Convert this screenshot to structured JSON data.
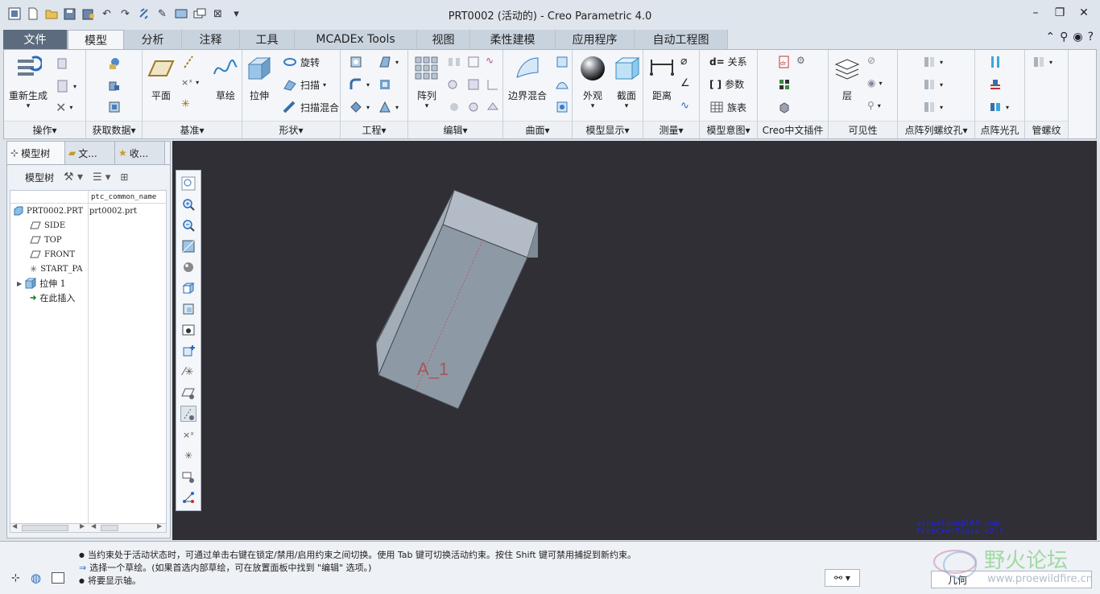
{
  "title": "PRT0002 (活动的) - Creo Parametric 4.0",
  "tabs": [
    "文件",
    "模型",
    "分析",
    "注释",
    "工具",
    "MCADEx Tools",
    "视图",
    "柔性建模",
    "应用程序",
    "自动工程图"
  ],
  "ribbon": {
    "regenerate": "重新生成",
    "plane": "平面",
    "sketch": "草绘",
    "extrude": "拉伸",
    "revolve": "旋转",
    "sweep": "扫描",
    "swept_blend": "扫描混合",
    "pattern": "阵列",
    "boundary_blend": "边界混合",
    "appearance": "外观",
    "section": "截面",
    "distance": "距离",
    "relations": "关系",
    "parameters": "参数",
    "family_table": "族表",
    "layer": "层",
    "groups": [
      "操作",
      "获取数据",
      "基准",
      "形状",
      "工程",
      "编辑",
      "曲面",
      "模型显示",
      "测量",
      "模型意图",
      "Creo中文插件",
      "可见性",
      "点阵列螺纹孔",
      "点阵光孔",
      "管螺纹"
    ]
  },
  "panel": {
    "tabs": [
      "模型树",
      "文...",
      "收..."
    ],
    "toolbar_label": "模型树",
    "column": "ptc_common_name",
    "rows": [
      {
        "name": "PRT0002.PRT",
        "value": "prt0002.prt"
      },
      {
        "name": "SIDE",
        "value": ""
      },
      {
        "name": "TOP",
        "value": ""
      },
      {
        "name": "FRONT",
        "value": ""
      },
      {
        "name": "START_PA",
        "value": ""
      },
      {
        "name": "拉伸 1",
        "value": ""
      },
      {
        "name": "在此插入",
        "value": ""
      }
    ]
  },
  "graphics": {
    "axis_label": "A_1",
    "watermark_line1": "visualsan@163.com",
    "watermark_line2": "FreeCreoTools v2.1"
  },
  "status": {
    "messages": [
      "当约束处于活动状态时，可通过单击右键在锁定/禁用/启用约束之间切换。使用 Tab 键可切换活动约束。按住 Shift 键可禁用捕捉到新约束。",
      "选择一个草绘。(如果首选内部草绘，可在放置面板中找到 \"编辑\" 选项。)",
      "将要显示轴。"
    ],
    "filter": "几何",
    "forum_name": "野火论坛",
    "forum_url": "www.proewildfire.cn"
  },
  "colors": {
    "graphics_bg": "#2f2f35",
    "part": "#8e99a6",
    "file_tab": "#5c6c7e"
  }
}
